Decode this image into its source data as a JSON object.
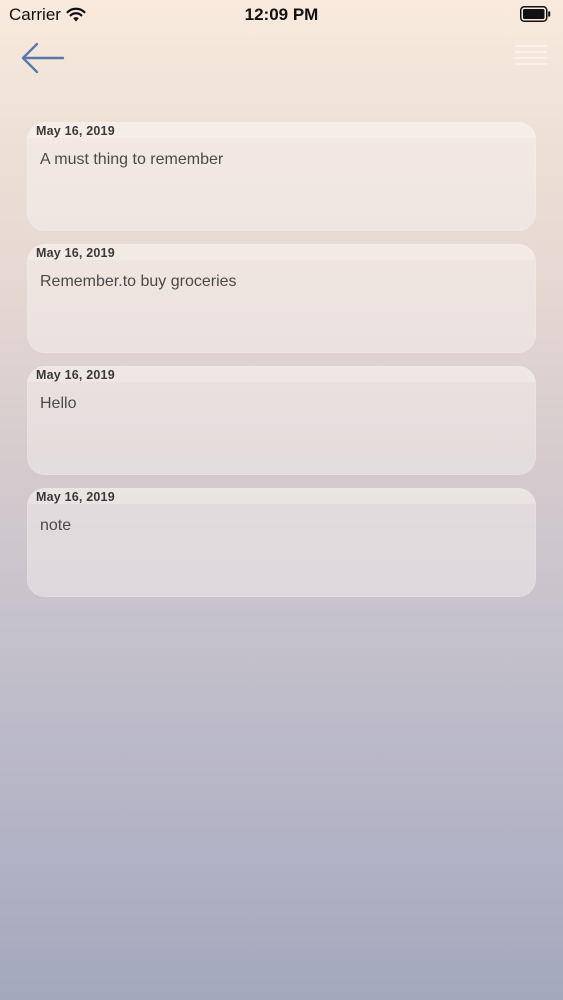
{
  "status_bar": {
    "carrier": "Carrier",
    "time": "12:09 PM",
    "icons": [
      "wifi-icon",
      "battery-icon"
    ]
  },
  "nav": {
    "back_icon": "arrow-left-icon",
    "menu_icon": "hamburger-menu-icon",
    "accent_color": "#5a78b0"
  },
  "notes": [
    {
      "date": "May 16, 2019",
      "text": "A must thing to remember"
    },
    {
      "date": "May 16, 2019",
      "text": "Remember.to buy groceries"
    },
    {
      "date": "May 16, 2019",
      "text": "Hello"
    },
    {
      "date": "May 16, 2019",
      "text": "note"
    }
  ]
}
